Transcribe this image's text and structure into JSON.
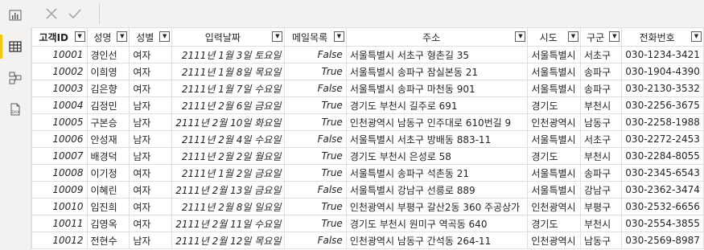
{
  "sidebar": {
    "items": [
      {
        "name": "report-view",
        "icon": "bar-chart-icon"
      },
      {
        "name": "data-view",
        "icon": "table-grid-icon",
        "active": true
      },
      {
        "name": "model-view",
        "icon": "model-diagram-icon"
      },
      {
        "name": "dax-query-view",
        "icon": "dax-icon",
        "icon_text": "DAX"
      }
    ]
  },
  "formula_bar": {
    "cancel_icon": "close-icon",
    "commit_icon": "check-icon",
    "value": ""
  },
  "table": {
    "columns": [
      "고객ID",
      "성명",
      "성별",
      "입력날짜",
      "메일목록",
      "주소",
      "시도",
      "구군",
      "전화번호"
    ],
    "rows": [
      [
        "10001",
        "경인선",
        "여자",
        "2111년 1월 3일 토요일",
        "False",
        "서울특별시 서초구 형촌길 35",
        "서울특별시",
        "서초구",
        "030-1234-3421"
      ],
      [
        "10002",
        "이희영",
        "여자",
        "2111년 1월 8일 목요일",
        "True",
        "서울특별시 송파구 잠실본동 21",
        "서울특별시",
        "송파구",
        "030-1904-4390"
      ],
      [
        "10003",
        "김은향",
        "여자",
        "2111년 1월 7일 수요일",
        "False",
        "서울특별시 송파구 마천동 901",
        "서울특별시",
        "송파구",
        "030-2130-3532"
      ],
      [
        "10004",
        "김정민",
        "남자",
        "2111년 2월 6일 금요일",
        "True",
        "경기도 부천시 길주로 691",
        "경기도",
        "부천시",
        "030-2256-3675"
      ],
      [
        "10005",
        "구본승",
        "남자",
        "2111년 2월 10일 화요일",
        "True",
        "인천광역시 남동구 인주대로 610번길 9",
        "인천광역시",
        "남동구",
        "030-2258-1988"
      ],
      [
        "10006",
        "안성재",
        "남자",
        "2111년 2월 4일 수요일",
        "False",
        "서울특별시 서초구 방배동 883-11",
        "서울특별시",
        "서초구",
        "030-2272-2453"
      ],
      [
        "10007",
        "배경덕",
        "남자",
        "2111년 2월 2일 월요일",
        "True",
        "경기도 부천시 은성로 58",
        "경기도",
        "부천시",
        "030-2284-8055"
      ],
      [
        "10008",
        "이기정",
        "여자",
        "2111년 1월 2일 금요일",
        "True",
        "서울특별시 송파구 석촌동 21",
        "서울특별시",
        "송파구",
        "030-2345-6543"
      ],
      [
        "10009",
        "이혜린",
        "여자",
        "2111년 2월 13일 금요일",
        "False",
        "서울특별시 강남구 선릉로 889",
        "서울특별시",
        "강남구",
        "030-2362-3474"
      ],
      [
        "10010",
        "임진희",
        "여자",
        "2111년 2월 8일 일요일",
        "True",
        "인천광역시 부평구 갈산2동 360 주공상가",
        "인천광역시",
        "부평구",
        "030-2532-6656"
      ],
      [
        "10011",
        "김영옥",
        "여자",
        "2111년 2월 11일 수요일",
        "True",
        "경기도 부천시 원미구 역곡동 640",
        "경기도",
        "부천시",
        "030-2554-3855"
      ],
      [
        "10012",
        "전현수",
        "남자",
        "2111년 2월 12일 목요일",
        "False",
        "인천광역시 남동구 간석동 264-11",
        "인천광역시",
        "남동구",
        "030-2569-8987"
      ]
    ]
  },
  "colors": {
    "accent": "#f2c811",
    "grid_line": "#e1dfdd",
    "chrome": "#f3f2f1"
  }
}
